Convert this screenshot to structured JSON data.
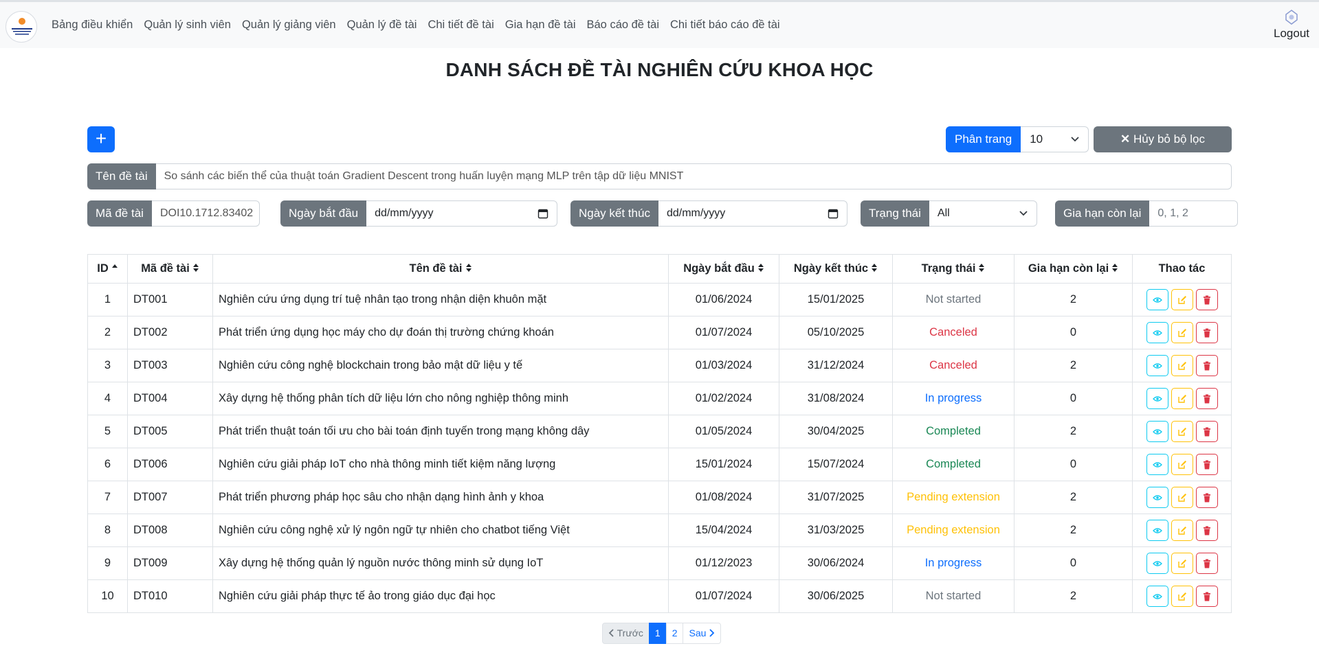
{
  "nav": {
    "links": [
      "Bảng điều khiển",
      "Quản lý sinh viên",
      "Quản lý giảng viên",
      "Quản lý đề tài",
      "Chi tiết đề tài",
      "Gia hạn đề tài",
      "Báo cáo đề tài",
      "Chi tiết báo cáo đề tài"
    ],
    "logout": "Logout"
  },
  "title": "DANH SÁCH ĐỀ TÀI NGHIÊN CỨU KHOA HỌC",
  "toolbar": {
    "add_label": "+",
    "pagination_label": "Phân trang",
    "pagination_value": "10",
    "clear_filter_label": "Hủy bỏ bộ lọc"
  },
  "filters": {
    "topic_name": {
      "label": "Tên đề tài",
      "value": "So sánh các biến thể của thuật toán Gradient Descent trong huấn luyện mạng MLP trên tập dữ liệu MNIST"
    },
    "topic_code": {
      "label": "Mã đề tài",
      "value": "DOI10.1712.83402"
    },
    "start_date": {
      "label": "Ngày bắt đầu",
      "value": "dd/mm/yyyy"
    },
    "end_date": {
      "label": "Ngày kết thúc",
      "value": "dd/mm/yyyy"
    },
    "status": {
      "label": "Trạng thái",
      "value": "All"
    },
    "extension": {
      "label": "Gia hạn còn lại",
      "placeholder": "0, 1, 2"
    }
  },
  "table": {
    "headers": [
      "ID",
      "Mã đề tài",
      "Tên đề tài",
      "Ngày bắt đầu",
      "Ngày kết thúc",
      "Trạng thái",
      "Gia hạn còn lại",
      "Thao tác"
    ],
    "rows": [
      {
        "id": "1",
        "code": "DT001",
        "name": "Nghiên cứu ứng dụng trí tuệ nhân tạo trong nhận diện khuôn mặt",
        "start": "01/06/2024",
        "end": "15/01/2025",
        "status": "Not started",
        "status_key": "started",
        "ext": "2"
      },
      {
        "id": "2",
        "code": "DT002",
        "name": "Phát triển ứng dụng học máy cho dự đoán thị trường chứng khoán",
        "start": "01/07/2024",
        "end": "05/10/2025",
        "status": "Canceled",
        "status_key": "canceled",
        "ext": "0"
      },
      {
        "id": "3",
        "code": "DT003",
        "name": "Nghiên cứu công nghệ blockchain trong bảo mật dữ liệu y tế",
        "start": "01/03/2024",
        "end": "31/12/2024",
        "status": "Canceled",
        "status_key": "canceled",
        "ext": "2"
      },
      {
        "id": "4",
        "code": "DT004",
        "name": "Xây dựng hệ thống phân tích dữ liệu lớn cho nông nghiệp thông minh",
        "start": "01/02/2024",
        "end": "31/08/2024",
        "status": "In progress",
        "status_key": "progress",
        "ext": "0"
      },
      {
        "id": "5",
        "code": "DT005",
        "name": "Phát triển thuật toán tối ưu cho bài toán định tuyến trong mạng không dây",
        "start": "01/05/2024",
        "end": "30/04/2025",
        "status": "Completed",
        "status_key": "completed",
        "ext": "2"
      },
      {
        "id": "6",
        "code": "DT006",
        "name": "Nghiên cứu giải pháp IoT cho nhà thông minh tiết kiệm năng lượng",
        "start": "15/01/2024",
        "end": "15/07/2024",
        "status": "Completed",
        "status_key": "completed",
        "ext": "0"
      },
      {
        "id": "7",
        "code": "DT007",
        "name": "Phát triển phương pháp học sâu cho nhận dạng hình ảnh y khoa",
        "start": "01/08/2024",
        "end": "31/07/2025",
        "status": "Pending extension",
        "status_key": "pending",
        "ext": "2"
      },
      {
        "id": "8",
        "code": "DT008",
        "name": "Nghiên cứu công nghệ xử lý ngôn ngữ tự nhiên cho chatbot tiếng Việt",
        "start": "15/04/2024",
        "end": "31/03/2025",
        "status": "Pending extension",
        "status_key": "pending",
        "ext": "2"
      },
      {
        "id": "9",
        "code": "DT009",
        "name": "Xây dựng hệ thống quản lý nguồn nước thông minh sử dụng IoT",
        "start": "01/12/2023",
        "end": "30/06/2024",
        "status": "In progress",
        "status_key": "progress",
        "ext": "0"
      },
      {
        "id": "10",
        "code": "DT010",
        "name": "Nghiên cứu giải pháp thực tế ảo trong giáo dục đại học",
        "start": "01/07/2024",
        "end": "30/06/2025",
        "status": "Not started",
        "status_key": "started",
        "ext": "2"
      }
    ]
  },
  "pagination": {
    "prev": "Trước",
    "pages": [
      "1",
      "2"
    ],
    "active": "1",
    "next": "Sau"
  },
  "colors": {
    "primary": "#0d6efd",
    "secondary": "#6c757d",
    "danger": "#dc3545",
    "success": "#198754",
    "warning": "#ffc107",
    "info": "#0dcaf0"
  }
}
